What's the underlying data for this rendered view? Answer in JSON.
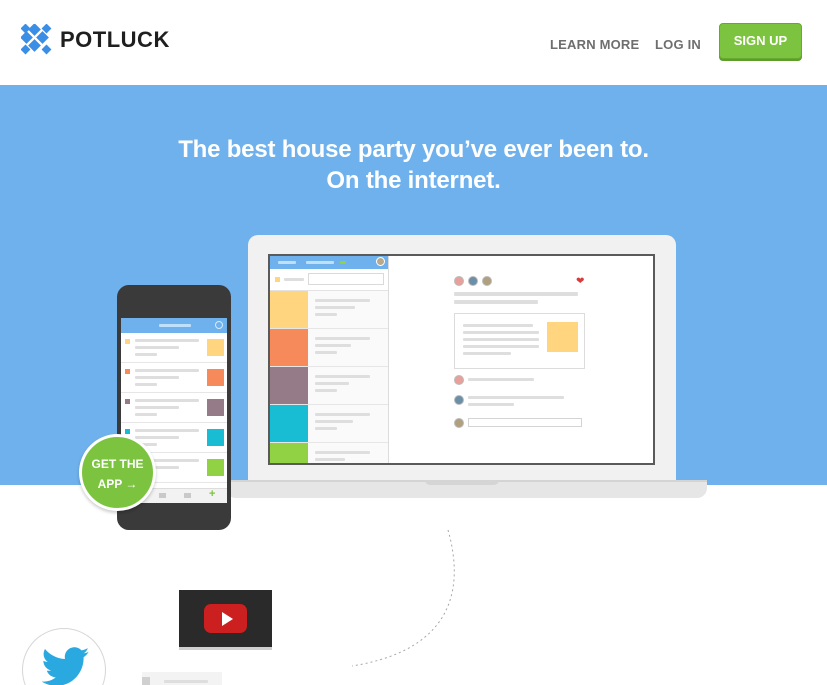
{
  "brand": {
    "name": "POTLUCK",
    "logo_color": "#3a8ee6"
  },
  "nav": {
    "learn_more": "LEARN MORE",
    "log_in": "LOG IN",
    "sign_up": "SIGN UP"
  },
  "hero": {
    "line1": "The best house party you’ve ever been to.",
    "line2": "On the internet.",
    "background": "#6fb1ec"
  },
  "get_app": {
    "line1": "GET THE",
    "line2": "APP →"
  },
  "colors": {
    "accent_green": "#7cc43f",
    "swatches": [
      "#ffd67f",
      "#f78a5a",
      "#957a88",
      "#19bdd3",
      "#91d244"
    ]
  },
  "icons": [
    "logo-icon",
    "heart-icon",
    "youtube-play-icon",
    "twitter-bird-icon",
    "arrow-right-icon"
  ]
}
